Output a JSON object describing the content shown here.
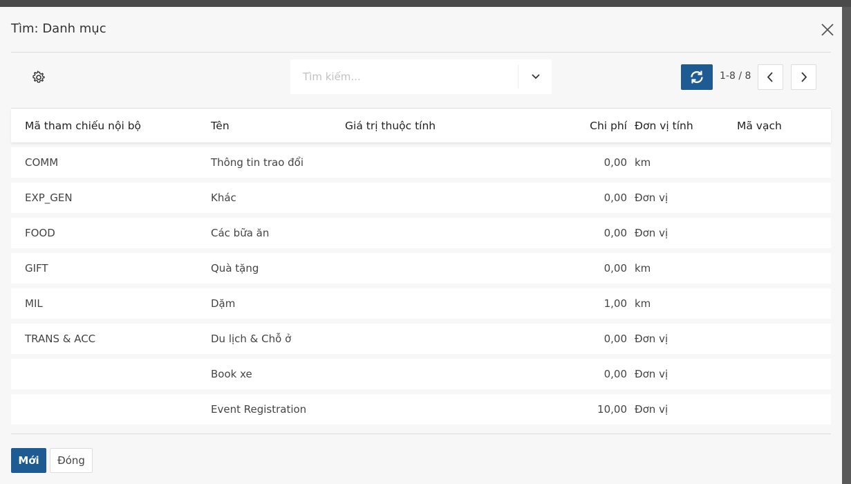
{
  "dialog": {
    "title": "Tìm: Danh mục"
  },
  "search": {
    "placeholder": "Tìm kiếm..."
  },
  "pager": {
    "range": "1-8 / 8"
  },
  "table": {
    "columns": [
      "Mã tham chiếu nội bộ",
      "Tên",
      "Giá trị thuộc tính",
      "Chi phí",
      "Đơn vị tính",
      "Mã vạch"
    ],
    "rows": [
      {
        "ref": "COMM",
        "name": "Thông tin trao đổi",
        "attr": "",
        "cost": "0,00",
        "uom": "km",
        "barcode": ""
      },
      {
        "ref": "EXP_GEN",
        "name": "Khác",
        "attr": "",
        "cost": "0,00",
        "uom": "Đơn vị",
        "barcode": ""
      },
      {
        "ref": "FOOD",
        "name": "Các bữa ăn",
        "attr": "",
        "cost": "0,00",
        "uom": "Đơn vị",
        "barcode": ""
      },
      {
        "ref": "GIFT",
        "name": "Quà tặng",
        "attr": "",
        "cost": "0,00",
        "uom": "km",
        "barcode": ""
      },
      {
        "ref": "MIL",
        "name": "Dặm",
        "attr": "",
        "cost": "1,00",
        "uom": "km",
        "barcode": ""
      },
      {
        "ref": "TRANS & ACC",
        "name": "Du lịch & Chỗ ở",
        "attr": "",
        "cost": "0,00",
        "uom": "Đơn vị",
        "barcode": ""
      },
      {
        "ref": "",
        "name": "Book xe",
        "attr": "",
        "cost": "0,00",
        "uom": "Đơn vị",
        "barcode": ""
      },
      {
        "ref": "",
        "name": "Event Registration",
        "attr": "",
        "cost": "10,00",
        "uom": "Đơn vị",
        "barcode": ""
      }
    ]
  },
  "footer": {
    "new_label": "Mới",
    "close_label": "Đóng"
  },
  "icons": {
    "close": "close-icon",
    "settings": "gear-icon",
    "dropdown": "chevron-down-icon",
    "refresh": "refresh-icon",
    "prev": "chevron-left-icon",
    "next": "chevron-right-icon"
  },
  "colors": {
    "primary": "#1e5b93"
  }
}
